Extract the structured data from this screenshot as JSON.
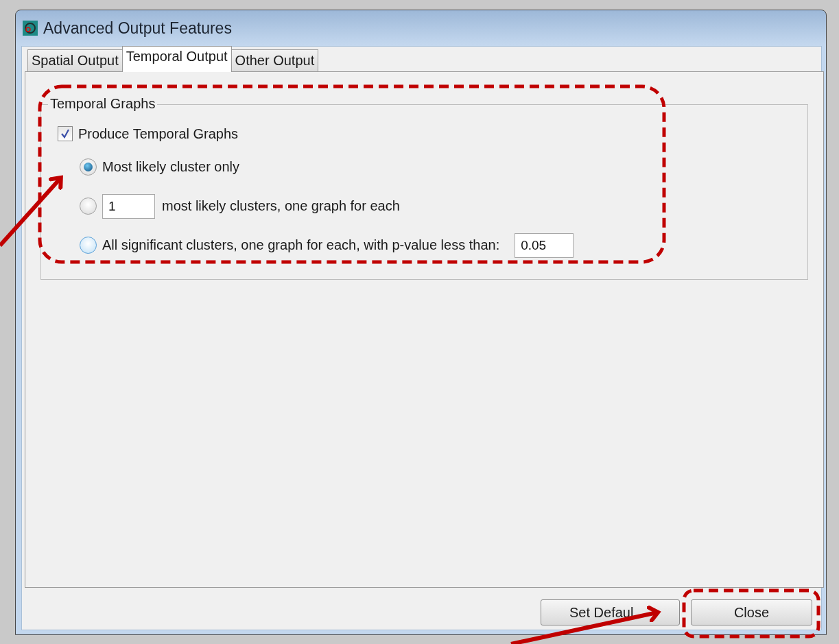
{
  "window": {
    "title": "Advanced Output Features"
  },
  "tabs": [
    {
      "label": "Spatial Output",
      "selected": false
    },
    {
      "label": "Temporal Output",
      "selected": true
    },
    {
      "label": "Other Output",
      "selected": false
    }
  ],
  "group": {
    "title": "Temporal Graphs",
    "produce": {
      "label": "Produce Temporal Graphs",
      "checked": true
    },
    "options": [
      {
        "kind": "plain",
        "label": "Most likely cluster only",
        "selected": true
      },
      {
        "kind": "count",
        "value": "1",
        "suffix": "most likely clusters, one graph for each",
        "selected": false
      },
      {
        "kind": "threshold",
        "label": "All significant clusters, one graph for each, with p-value less than:",
        "value": "0.05",
        "selected": false
      }
    ]
  },
  "buttons": [
    {
      "label": "Set Defaul"
    },
    {
      "label": "Close"
    }
  ]
}
